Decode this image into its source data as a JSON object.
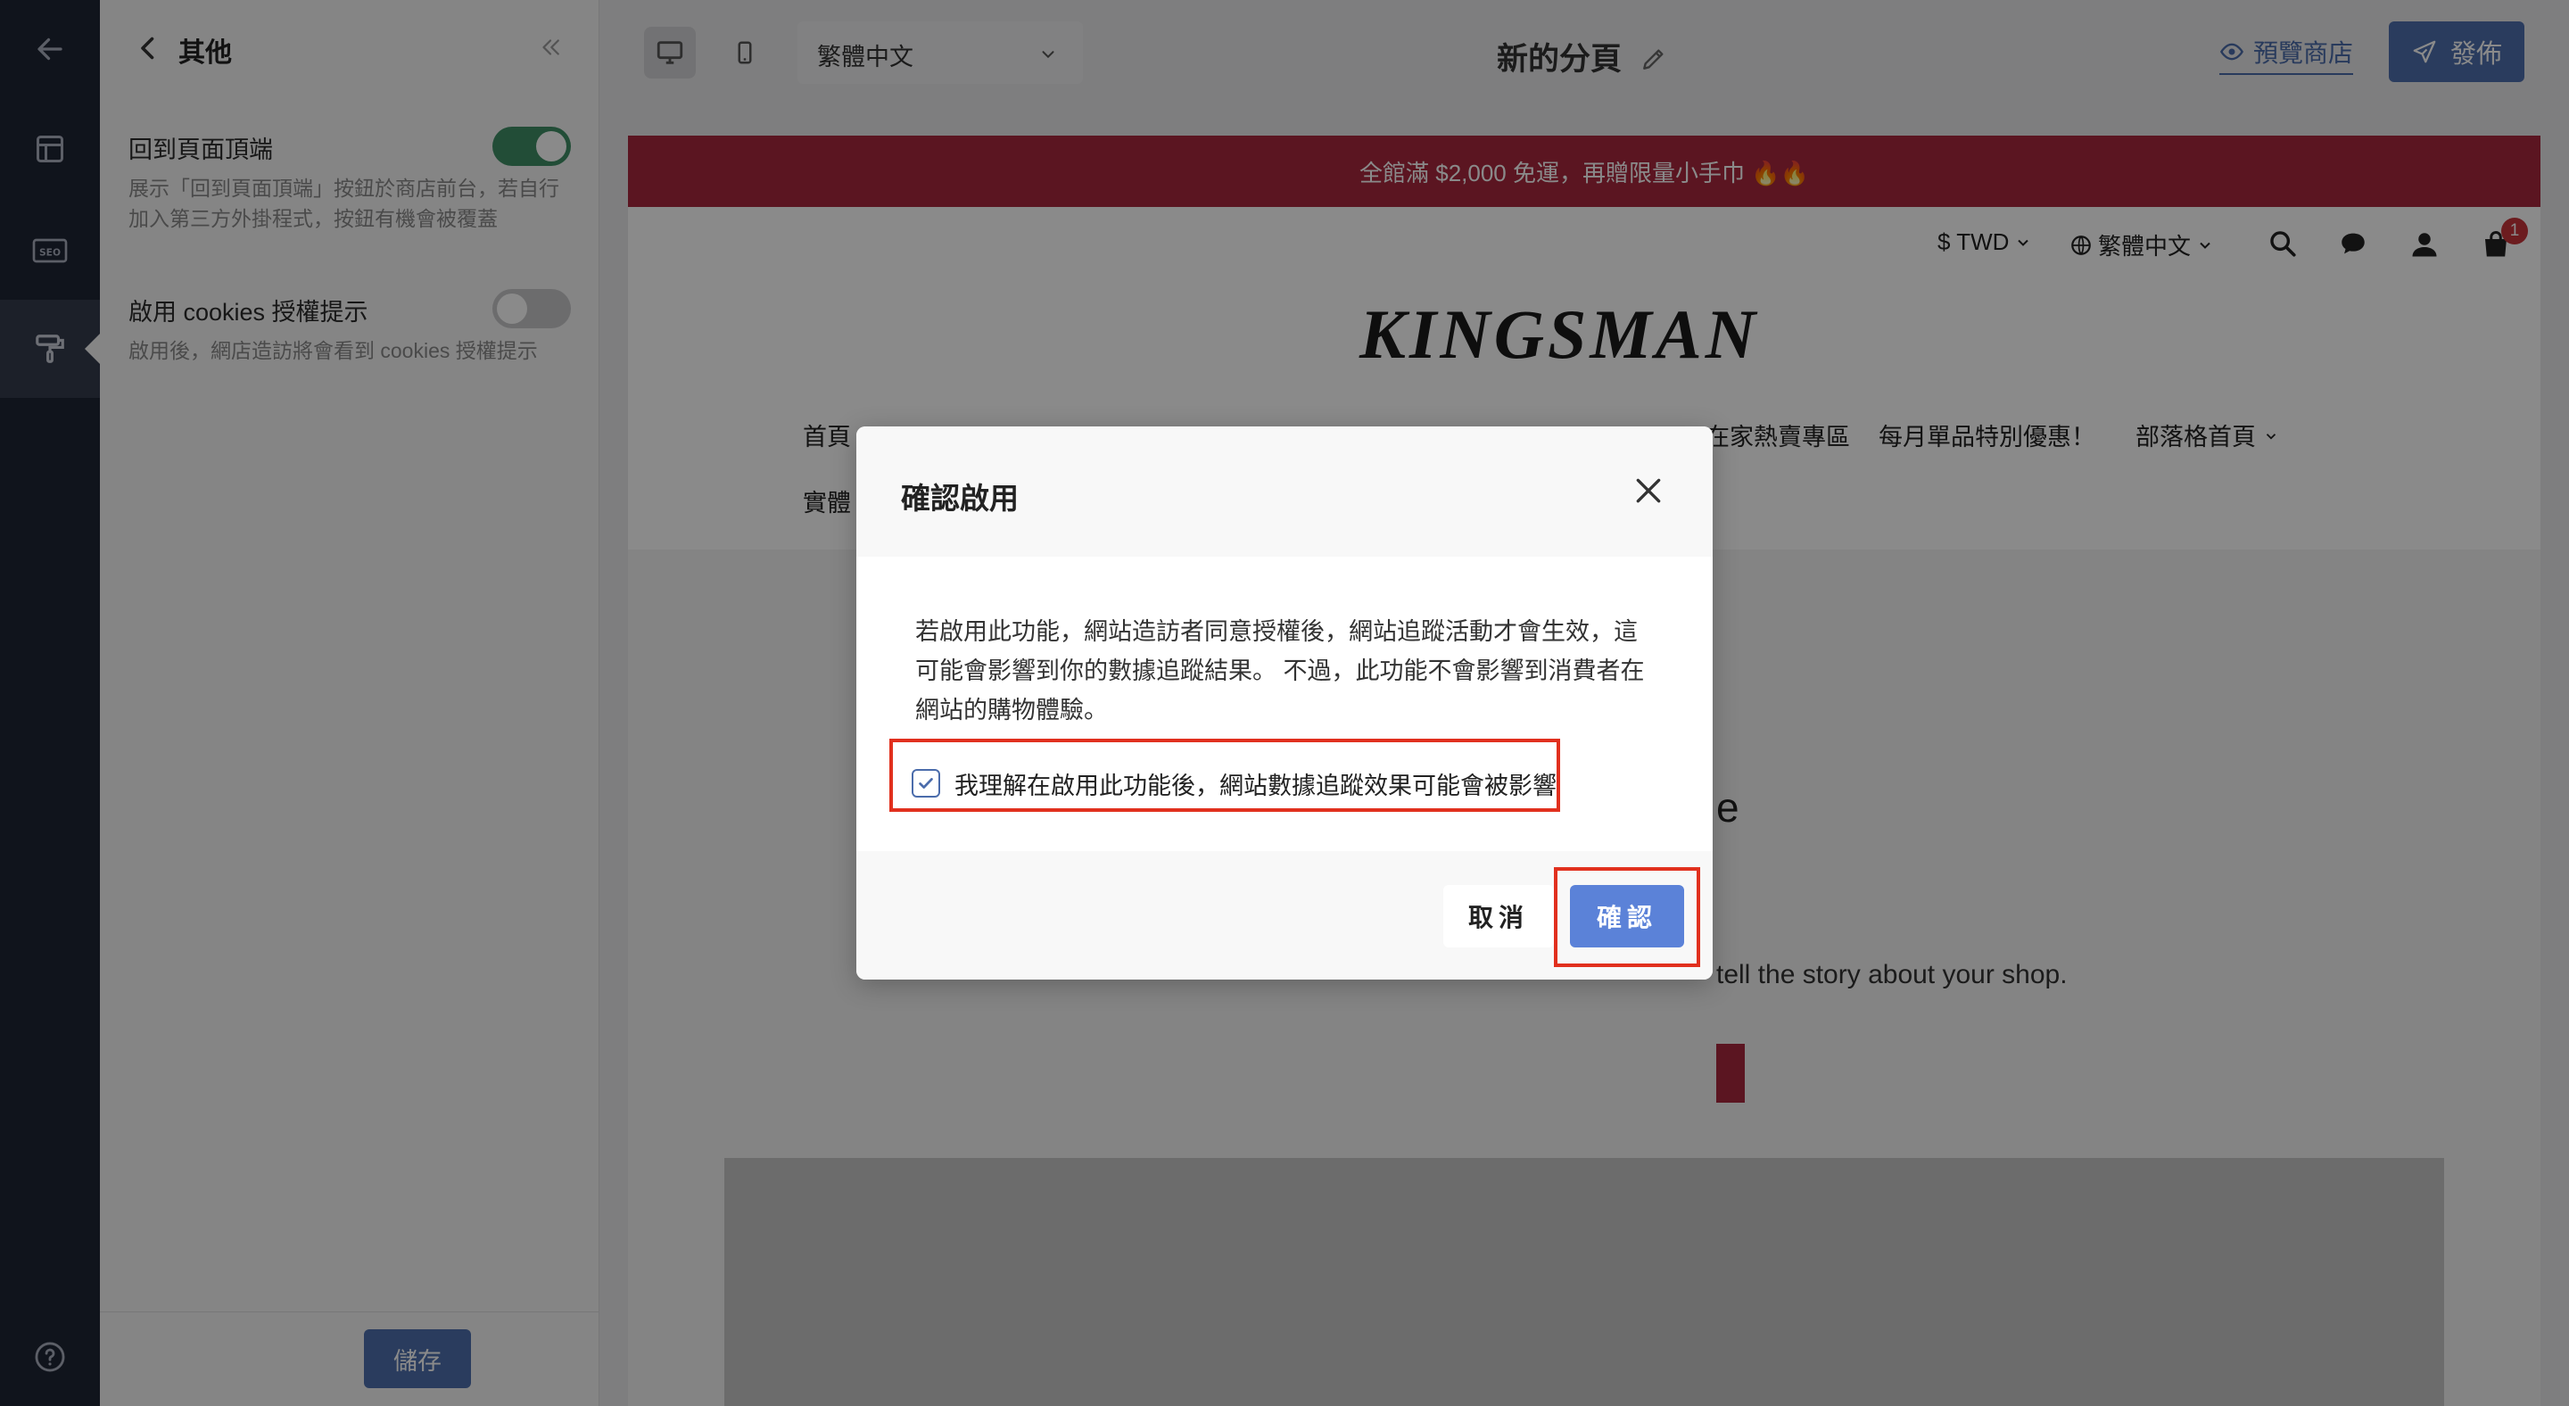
{
  "panel": {
    "title": "其他",
    "settings": [
      {
        "label": "回到頁面頂端",
        "description": "展示「回到頁面頂端」按鈕於商店前台，若自行加入第三方外掛程式，按鈕有機會被覆蓋",
        "enabled": true
      },
      {
        "label": "啟用 cookies 授權提示",
        "description": "啟用後，網店造訪將會看到 cookies 授權提示",
        "enabled": false
      }
    ],
    "save_label": "儲存"
  },
  "topbar": {
    "language": "繁體中文",
    "page_title": "新的分頁",
    "preview_label": "預覽商店",
    "publish_label": "發佈"
  },
  "preview": {
    "banner": "全館滿 $2,000 免運，再贈限量小手巾 🔥🔥",
    "currency": "$ TWD",
    "language": "繁體中文",
    "cart_count": "1",
    "logo": "KINGSMAN",
    "nav": [
      "首頁",
      "在家熱賣專區",
      "每月單品特別優惠！",
      "部落格首頁"
    ],
    "nav_second_row": "實體",
    "hero_letter": "e",
    "hero_text": "tell the story about your shop."
  },
  "modal": {
    "title": "確認啟用",
    "body": "若啟用此功能，網站造訪者同意授權後，網站追蹤活動才會生效，這可能會影響到你的數據追蹤結果。 不過，此功能不會影響到消費者在網站的購物體驗。",
    "checkbox_label": "我理解在啟用此功能後，網站數據追蹤效果可能會被影響",
    "checkbox_checked": true,
    "cancel_label": "取消",
    "confirm_label": "確認"
  },
  "colors": {
    "rail": "#1f2535",
    "accent": "#4e6fae",
    "confirm": "#5b82d8",
    "toggle_on": "#3f8f66",
    "banner": "#a8283e",
    "highlight": "#e1301e"
  }
}
